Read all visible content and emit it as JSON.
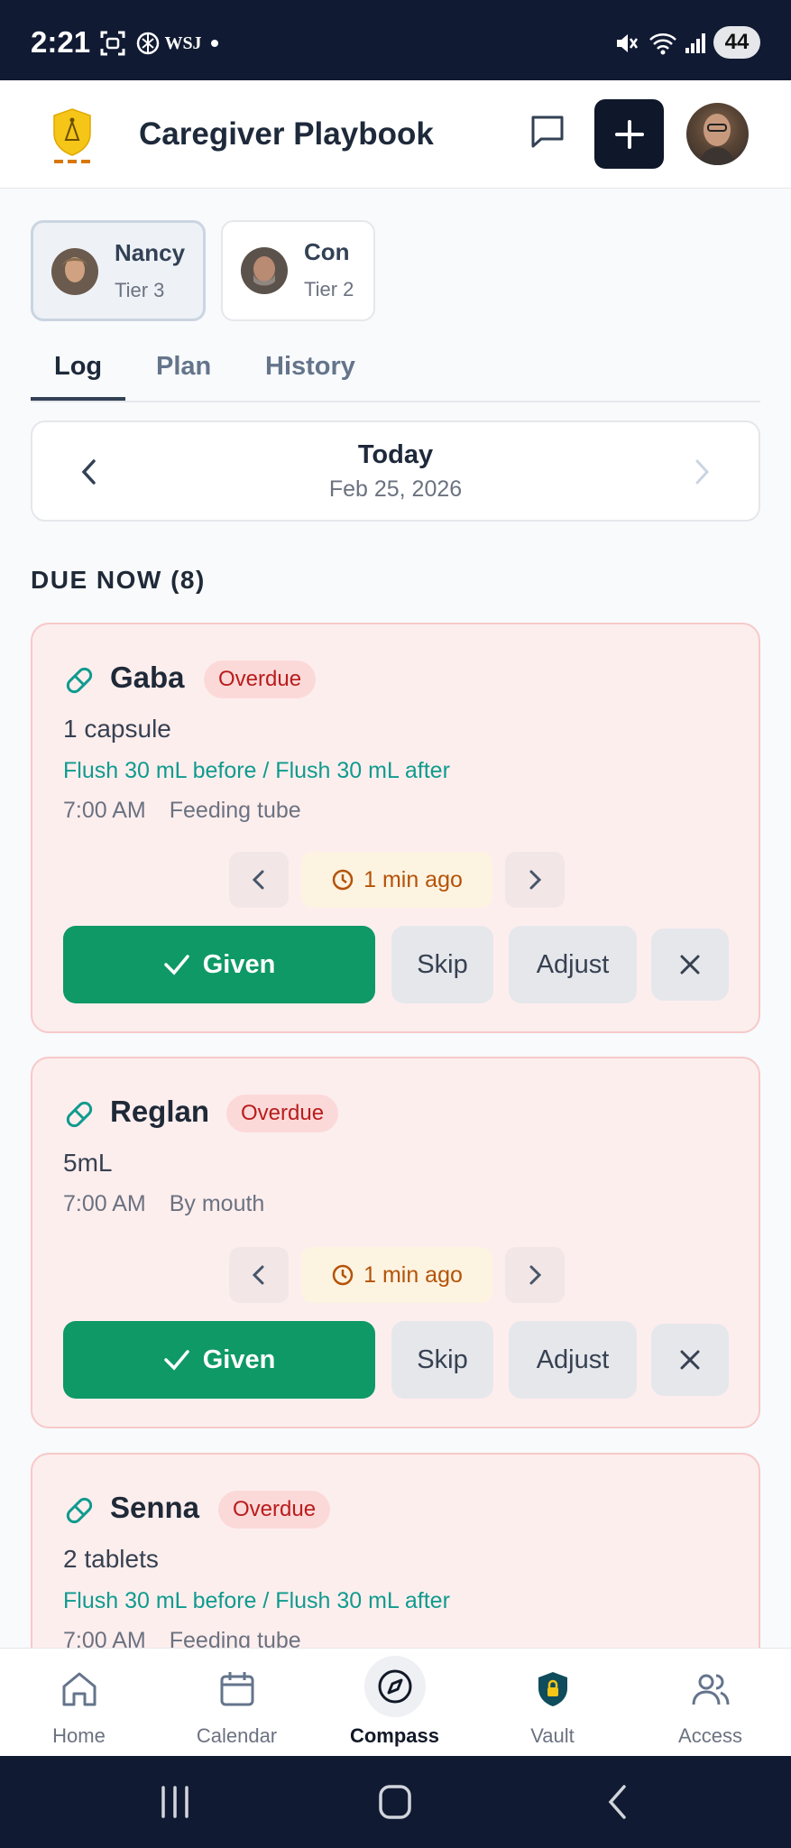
{
  "status_bar": {
    "time": "2:21",
    "source_label": "WSJ",
    "battery": "44",
    "icons": [
      "screenshot-icon",
      "openai-icon",
      "wsj-icon",
      "dot-icon",
      "mute-icon",
      "wifi-icon",
      "signal-icon",
      "battery-icon"
    ]
  },
  "header": {
    "title": "Caregiver Playbook",
    "icons": [
      "shield-logo-icon",
      "message-icon",
      "plus-icon",
      "avatar"
    ]
  },
  "people": [
    {
      "name": "Nancy",
      "tier": "Tier 3",
      "active": true
    },
    {
      "name": "Con",
      "tier": "Tier 2",
      "active": false
    }
  ],
  "tabs": [
    "Log",
    "Plan",
    "History"
  ],
  "date_nav": {
    "day": "Today",
    "date": "Feb 25, 2026"
  },
  "section": {
    "title": "DUE NOW (8)"
  },
  "meds": [
    {
      "name": "Gaba",
      "status": "Overdue",
      "dose": "1 capsule",
      "flush": "Flush 30 mL before / Flush 30 mL after",
      "time": "7:00 AM",
      "route": "Feeding tube",
      "elapsed": "1 min ago",
      "actions": {
        "given": "Given",
        "skip": "Skip",
        "adjust": "Adjust"
      }
    },
    {
      "name": "Reglan",
      "status": "Overdue",
      "dose": "5mL",
      "flush": "",
      "time": "7:00 AM",
      "route": "By mouth",
      "elapsed": "1 min ago",
      "actions": {
        "given": "Given",
        "skip": "Skip",
        "adjust": "Adjust"
      }
    },
    {
      "name": "Senna",
      "status": "Overdue",
      "dose": "2 tablets",
      "flush": "Flush 30 mL before / Flush 30 mL after",
      "time": "7:00 AM",
      "route": "Feeding tube"
    }
  ],
  "bottom_nav": [
    {
      "label": "Home",
      "icon": "home-icon"
    },
    {
      "label": "Calendar",
      "icon": "calendar-icon"
    },
    {
      "label": "Compass",
      "icon": "compass-icon",
      "active": true
    },
    {
      "label": "Vault",
      "icon": "vault-icon"
    },
    {
      "label": "Access",
      "icon": "users-icon"
    }
  ],
  "colors": {
    "status_bar": "#111a33",
    "primary_dark": "#0f172a",
    "given_green": "#0e9966",
    "overdue_red": "#b91c1c",
    "card_bg": "#fdeeee",
    "flush_teal": "#0f9b8e",
    "time_amber": "#b45309"
  }
}
